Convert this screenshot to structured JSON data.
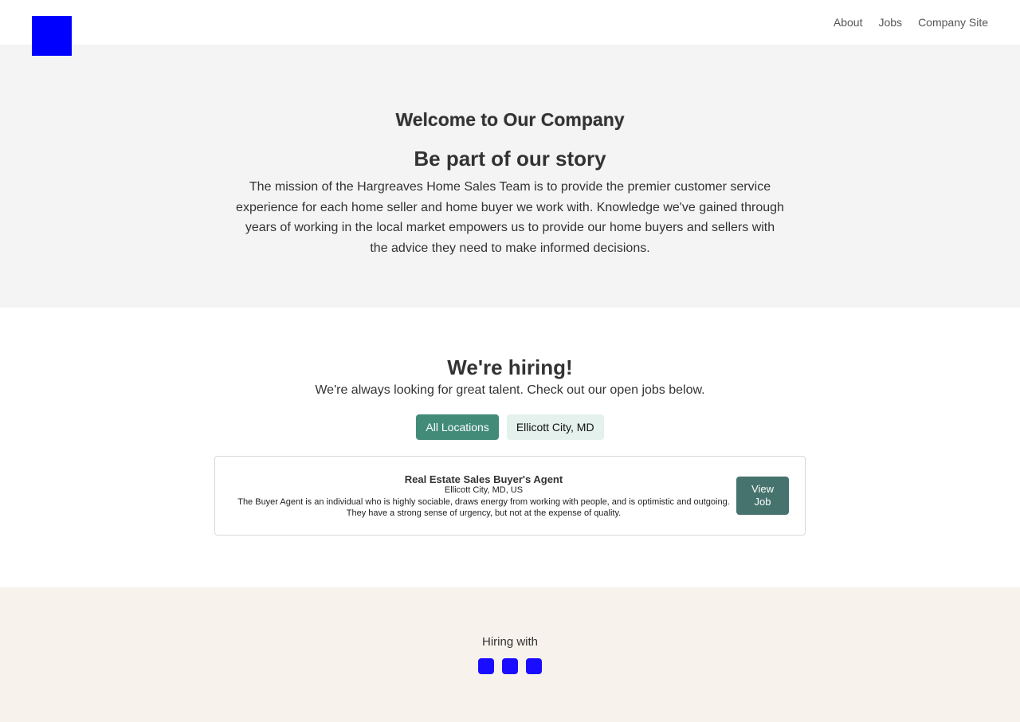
{
  "header": {
    "nav": [
      {
        "label": "About"
      },
      {
        "label": "Jobs"
      },
      {
        "label": "Company Site"
      }
    ]
  },
  "hero": {
    "welcome": "Welcome to Our Company",
    "tagline": "Be part of our story",
    "mission": "The mission of the Hargreaves Home Sales Team is to provide the premier customer service experience for each home seller and home buyer we work with. Knowledge we've gained through years of working in the local market empowers us to provide our home buyers and sellers with the advice they need to make informed decisions."
  },
  "jobs": {
    "title": "We're hiring!",
    "subtitle": "We're always looking for great talent. Check out our open jobs below.",
    "filters": [
      {
        "label": "All Locations",
        "active": true
      },
      {
        "label": "Ellicott City, MD",
        "active": false
      }
    ],
    "listings": [
      {
        "title": "Real Estate Sales Buyer's Agent",
        "location": "Ellicott City, MD, US",
        "description": "The Buyer Agent is an individual who is highly sociable, draws energy from working with people, and is optimistic and outgoing. They have a strong sense of urgency, but not at the expense of quality.",
        "button_label": "View Job"
      }
    ]
  },
  "footer": {
    "hiring_with": "Hiring with",
    "partners": [
      {
        "icon": "partner-logo-icon"
      },
      {
        "icon": "partner-logo-icon"
      },
      {
        "icon": "partner-logo-icon"
      }
    ]
  },
  "colors": {
    "logo": "#0000ff",
    "filter_active": "#428b79",
    "filter_inactive": "#e4f1ed",
    "view_button": "#46736d",
    "hero_bg": "#f4f4f4",
    "footer_bg": "#f7f2ec",
    "partner_icon": "#1a0dff"
  }
}
